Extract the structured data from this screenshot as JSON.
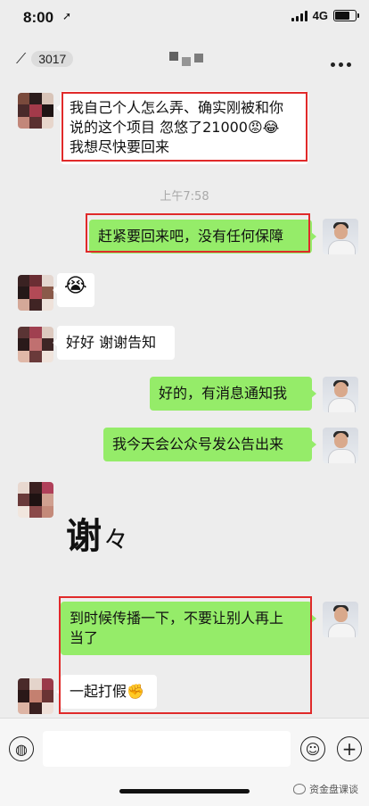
{
  "status_bar": {
    "time": "8:00",
    "network": "4G",
    "location_icon": "location-arrow-icon",
    "signal_icon": "signal-bars-icon",
    "battery_icon": "battery-icon"
  },
  "nav": {
    "back_icon": "chevron-left-icon",
    "unread_count": "3017",
    "title_redacted": true,
    "more_icon": "more-dots-icon"
  },
  "messages": [
    {
      "side": "left",
      "text_lines": [
        "我自己个人怎么弄、确实刚被和你",
        "说的这个项目 忽悠了21000😡😂",
        "我想尽快要回来"
      ],
      "highlighted": true
    },
    {
      "type": "timestamp",
      "text": "上午7:58"
    },
    {
      "side": "right",
      "text": "赶紧要回来吧，没有任何保障",
      "highlighted": true
    },
    {
      "side": "left",
      "text": "😭"
    },
    {
      "side": "left",
      "text": "好好 谢谢告知"
    },
    {
      "side": "right",
      "text": "好的，有消息通知我"
    },
    {
      "side": "right",
      "text": "我今天会公众号发公告出来"
    },
    {
      "side": "left",
      "type": "handwriting",
      "text_main": "谢",
      "text_repeat": "々"
    },
    {
      "side": "right",
      "text_lines": [
        "到时候传播一下，不要让别人再上",
        "当了"
      ],
      "highlighted": true
    },
    {
      "side": "left",
      "text": "一起打假✊",
      "highlighted": true
    }
  ],
  "input_bar": {
    "voice_icon": "voice-icon",
    "placeholder": "",
    "emoji_icon": "emoji-icon",
    "plus_icon": "plus-icon"
  },
  "watermark": {
    "text": "资金盘课谈",
    "logo_icon": "wechat-logo-icon"
  },
  "colors": {
    "background": "#ededed",
    "bubble_right": "#95ec69",
    "bubble_left": "#ffffff",
    "highlight_border": "#e02a2a"
  }
}
